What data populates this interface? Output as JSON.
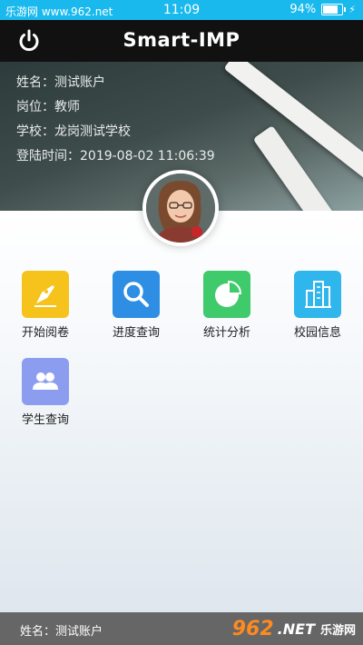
{
  "status_bar": {
    "watermark": "乐游网 www.962.net",
    "time": "11:09",
    "battery": "94%"
  },
  "header": {
    "title": "Smart-IMP"
  },
  "profile": {
    "name_row": "姓名：测试账户",
    "position_row": "岗位：教师",
    "school_row": "学校：龙岗测试学校",
    "login_row": "登陆时间：2019-08-02 11:06:39"
  },
  "menu": {
    "items": [
      {
        "label": "开始阅卷",
        "icon": "pen-nib-icon",
        "color": "#f6c31c"
      },
      {
        "label": "进度查询",
        "icon": "search-icon",
        "color": "#2d8ee3"
      },
      {
        "label": "统计分析",
        "icon": "pie-chart-icon",
        "color": "#3fca6b"
      },
      {
        "label": "校园信息",
        "icon": "building-icon",
        "color": "#2fb6ec"
      },
      {
        "label": "学生查询",
        "icon": "users-icon",
        "color": "#8c9df0"
      }
    ]
  },
  "bottom_bar": {
    "name": "姓名：测试账户",
    "watermark_number": "962",
    "watermark_suffix": ".NET",
    "watermark_cn": "乐游网"
  }
}
